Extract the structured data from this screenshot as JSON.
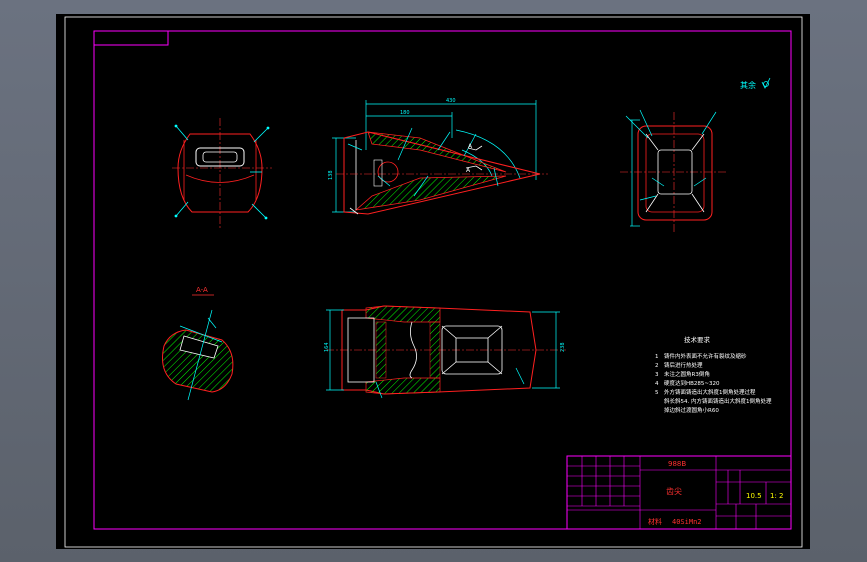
{
  "colors": {
    "canvas": "#000000",
    "frame": "#ff00ff",
    "outline": "#ff2020",
    "dimension": "#00ffff",
    "leader": "#ffffff",
    "hatch": "#00ff00",
    "centerline": "#ff3030",
    "note_text": "#ffffff",
    "title_text": "#ff3030",
    "accent_text": "#ffff00"
  },
  "drawing": {
    "corner_mark": "其余",
    "section_label": "A-A",
    "view_marker": "A"
  },
  "dims": {
    "top_total": "430",
    "top_partial": "180",
    "top_height": "138",
    "bottom_height": "164",
    "bottom_left": "104",
    "bottom_right": "238"
  },
  "notes": {
    "heading": "技术要求",
    "items": [
      {
        "num": "1",
        "text": "铸件内外表面不允许有裂纹及缩砂"
      },
      {
        "num": "2",
        "text": "铸后进行热处理"
      },
      {
        "num": "3",
        "text": "未注之圆角R3倒角"
      },
      {
        "num": "4",
        "text": "硬度达到HB285~320"
      },
      {
        "num": "5",
        "text": "外方铸面铸造出大斜度1倒角处理过程"
      },
      {
        "num": "",
        "text": "斜长斜54. 内方铸面铸造出大斜度1倒角处理"
      },
      {
        "num": "",
        "text": "掉边斜过渡圆角小R60"
      }
    ]
  },
  "title_block": {
    "project": "988B",
    "part_name": "齿尖",
    "material_label": "材料",
    "material": "40SiMn2",
    "weight": "10.5",
    "scale": "1: 2"
  }
}
